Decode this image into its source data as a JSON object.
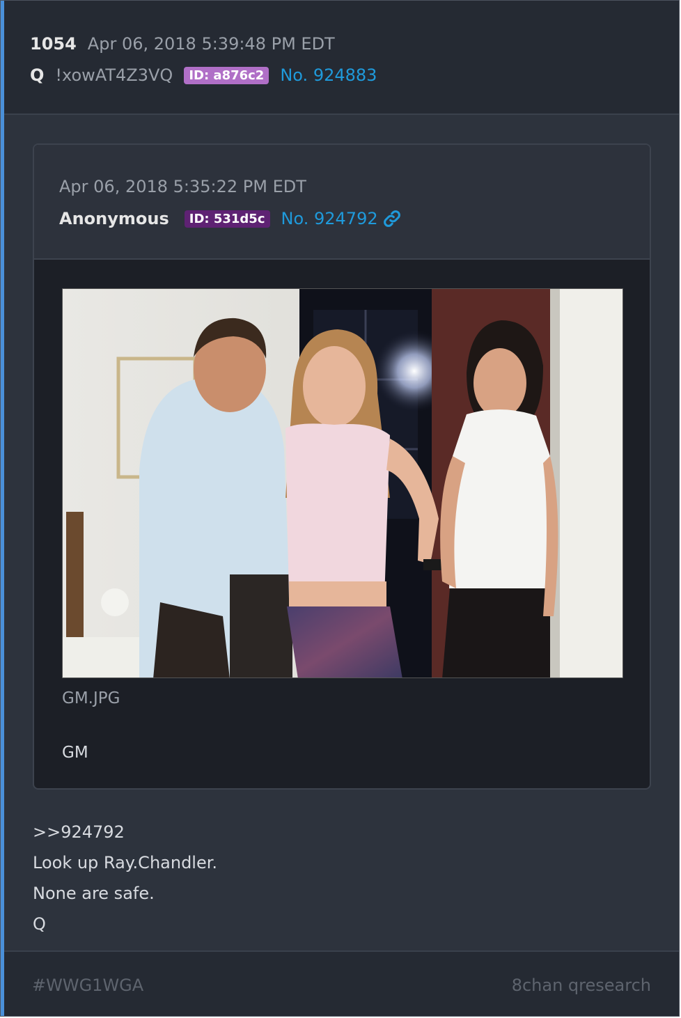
{
  "header": {
    "post_number": "1054",
    "date": "Apr 06, 2018 5:39:48 PM EDT",
    "author": "Q",
    "tripcode": "!xowAT4Z3VQ",
    "id_badge": "ID: a876c2",
    "post_no": "No. 924883"
  },
  "quoted_post": {
    "date": "Apr 06, 2018 5:35:22 PM EDT",
    "author": "Anonymous",
    "id_badge": "ID: 531d5c",
    "post_no": "No. 924792",
    "link_icon": "link-icon",
    "attachment": {
      "filename": "GM.JPG"
    },
    "message": "GM"
  },
  "body": {
    "lines": [
      ">>924792",
      "Look up Ray.Chandler.",
      "None are safe.",
      "Q"
    ]
  },
  "footer": {
    "tag": "#WWG1WGA",
    "source": "8chan qresearch"
  },
  "colors": {
    "accent": "#4a90d9",
    "link": "#1f9adb",
    "badge_q": "#b06fc7",
    "badge_anon": "#5e2273"
  }
}
